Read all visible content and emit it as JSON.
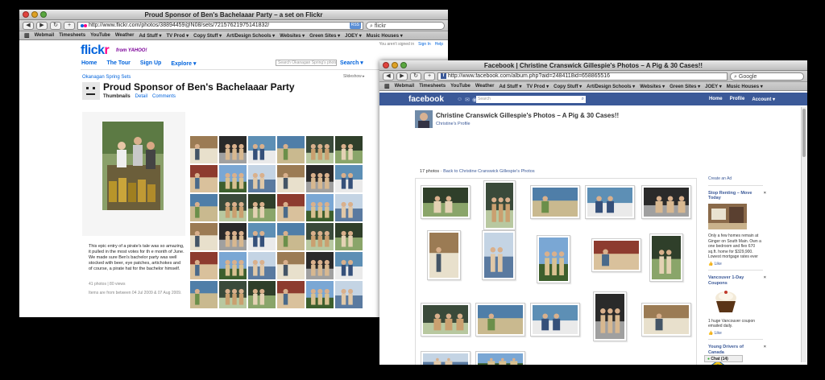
{
  "flickr": {
    "window_title": "Proud Sponsor of Ben's Bachelaaar Party – a set on Flickr",
    "url": "http://www.flickr.com/photos/38894459@N08/sets/72157621975141832/",
    "search_value": "flickr",
    "bookmarks": [
      "Webmail",
      "Timesheets",
      "YouTube",
      "Weather",
      "Ad Stuff ▾",
      "TV Prod ▾",
      "Copy Stuff ▾",
      "Art/Design Schools ▾",
      "Websites ▾",
      "Green Sites ▾",
      "JOEY ▾",
      "Music Houses ▾"
    ],
    "top_right": {
      "signed": "You aren't signed in",
      "sign_in": "Sign In",
      "help": "Help"
    },
    "logo_a": "flick",
    "logo_b": "r",
    "from_yahoo": "from YAHOO!",
    "nav": [
      "Home",
      "The Tour",
      "Sign Up",
      "Explore ▾"
    ],
    "search_placeholder": "Search Okanagan Spring's photos",
    "search_label": "Search ▾",
    "breadcrumb": "Okanagan Spring   Sets",
    "slideshow": "Slideshow ▸",
    "set_title": "Proud Sponsor of Ben's Bachelaaar Party",
    "tabs": {
      "thumbnails": "Thumbnails",
      "detail": "Detail",
      "comments": "Comments"
    },
    "description": "This epic entry of a pirate's tale was so amazing, it pulled in the most votes for th e month of June. We made sure Ben's bachelor party was well stocked with beer, eye patches, artichokes and of course, a pirate hat for the bachelor himself.",
    "meta_line1": "41 photos | 80 views",
    "meta_line2": "Items are from between 04 Jul 2009 & 07 Aug 2009."
  },
  "facebook": {
    "window_title": "Facebook | Christine Cranswick Gillespie's Photos – A Pig & 30 Cases!!",
    "url": "http://www.facebook.com/album.php?aid=2484118id=658865516",
    "search_value": "Google",
    "bookmarks": [
      "Webmail",
      "Timesheets",
      "YouTube",
      "Weather",
      "Ad Stuff ▾",
      "TV Prod ▾",
      "Copy Stuff ▾",
      "Art/Design Schools ▾",
      "Websites ▾",
      "Green Sites ▾",
      "JOEY ▾",
      "Music Houses ▾"
    ],
    "logo": "facebook",
    "search_placeholder": "Search",
    "top_links": [
      "Home",
      "Profile",
      "Account ▾"
    ],
    "album_title": "Christine Cranswick Gillespie's Photos – A Pig & 30 Cases!!",
    "profile_link": "Christine's Profile",
    "photo_count": "17 photos",
    "back_link": "Back to Christine Cranswick Gillespie's Photos",
    "sidebar": {
      "create_ad": "Create an Ad",
      "ads": [
        {
          "title": "Stop Renting – Move Today",
          "text": "Only a few homes remain at Ginger on South Main. Own a one bedroom and flex 670 sq.ft. home for $329,900. Lowest mortgage rates ever",
          "like": "Like"
        },
        {
          "title": "Vancouver 1-Day Coupons",
          "text": "1 huge Vancouver coupon emailed daily.",
          "like": "Like"
        },
        {
          "title": "Young Drivers of Canada",
          "text": "",
          "like": ""
        }
      ]
    },
    "chat": "Chat (14)"
  }
}
